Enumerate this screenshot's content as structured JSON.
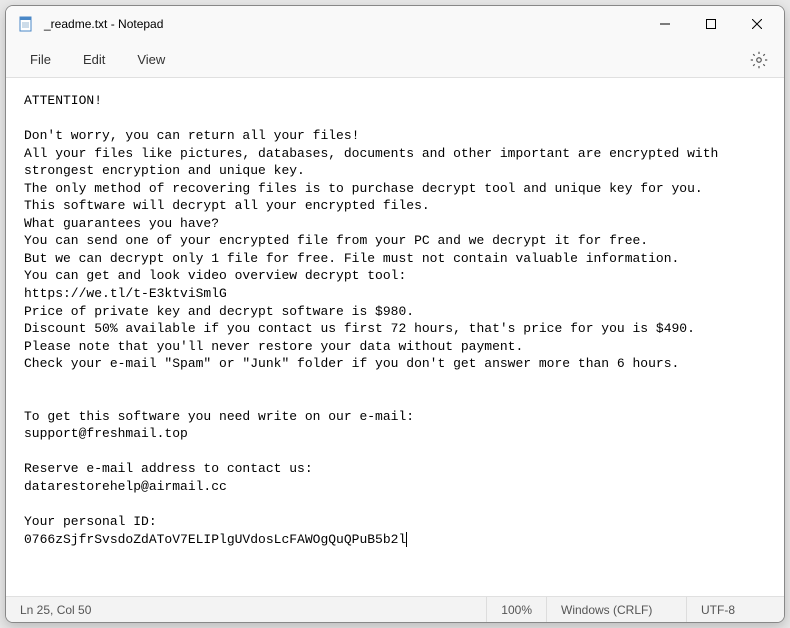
{
  "titlebar": {
    "title": "_readme.txt - Notepad"
  },
  "menubar": {
    "file": "File",
    "edit": "Edit",
    "view": "View"
  },
  "content": {
    "body": "ATTENTION!\n\nDon't worry, you can return all your files!\nAll your files like pictures, databases, documents and other important are encrypted with strongest encryption and unique key.\nThe only method of recovering files is to purchase decrypt tool and unique key for you.\nThis software will decrypt all your encrypted files.\nWhat guarantees you have?\nYou can send one of your encrypted file from your PC and we decrypt it for free.\nBut we can decrypt only 1 file for free. File must not contain valuable information.\nYou can get and look video overview decrypt tool:\nhttps://we.tl/t-E3ktviSmlG\nPrice of private key and decrypt software is $980.\nDiscount 50% available if you contact us first 72 hours, that's price for you is $490.\nPlease note that you'll never restore your data without payment.\nCheck your e-mail \"Spam\" or \"Junk\" folder if you don't get answer more than 6 hours.\n\n\nTo get this software you need write on our e-mail:\nsupport@freshmail.top\n\nReserve e-mail address to contact us:\ndatarestorehelp@airmail.cc\n\nYour personal ID:\n0766zSjfrSvsdoZdAToV7ELIPlgUVdosLcFAWOgQuQPuB5b2l"
  },
  "statusbar": {
    "position": "Ln 25, Col 50",
    "zoom": "100%",
    "line_ending": "Windows (CRLF)",
    "encoding": "UTF-8"
  }
}
